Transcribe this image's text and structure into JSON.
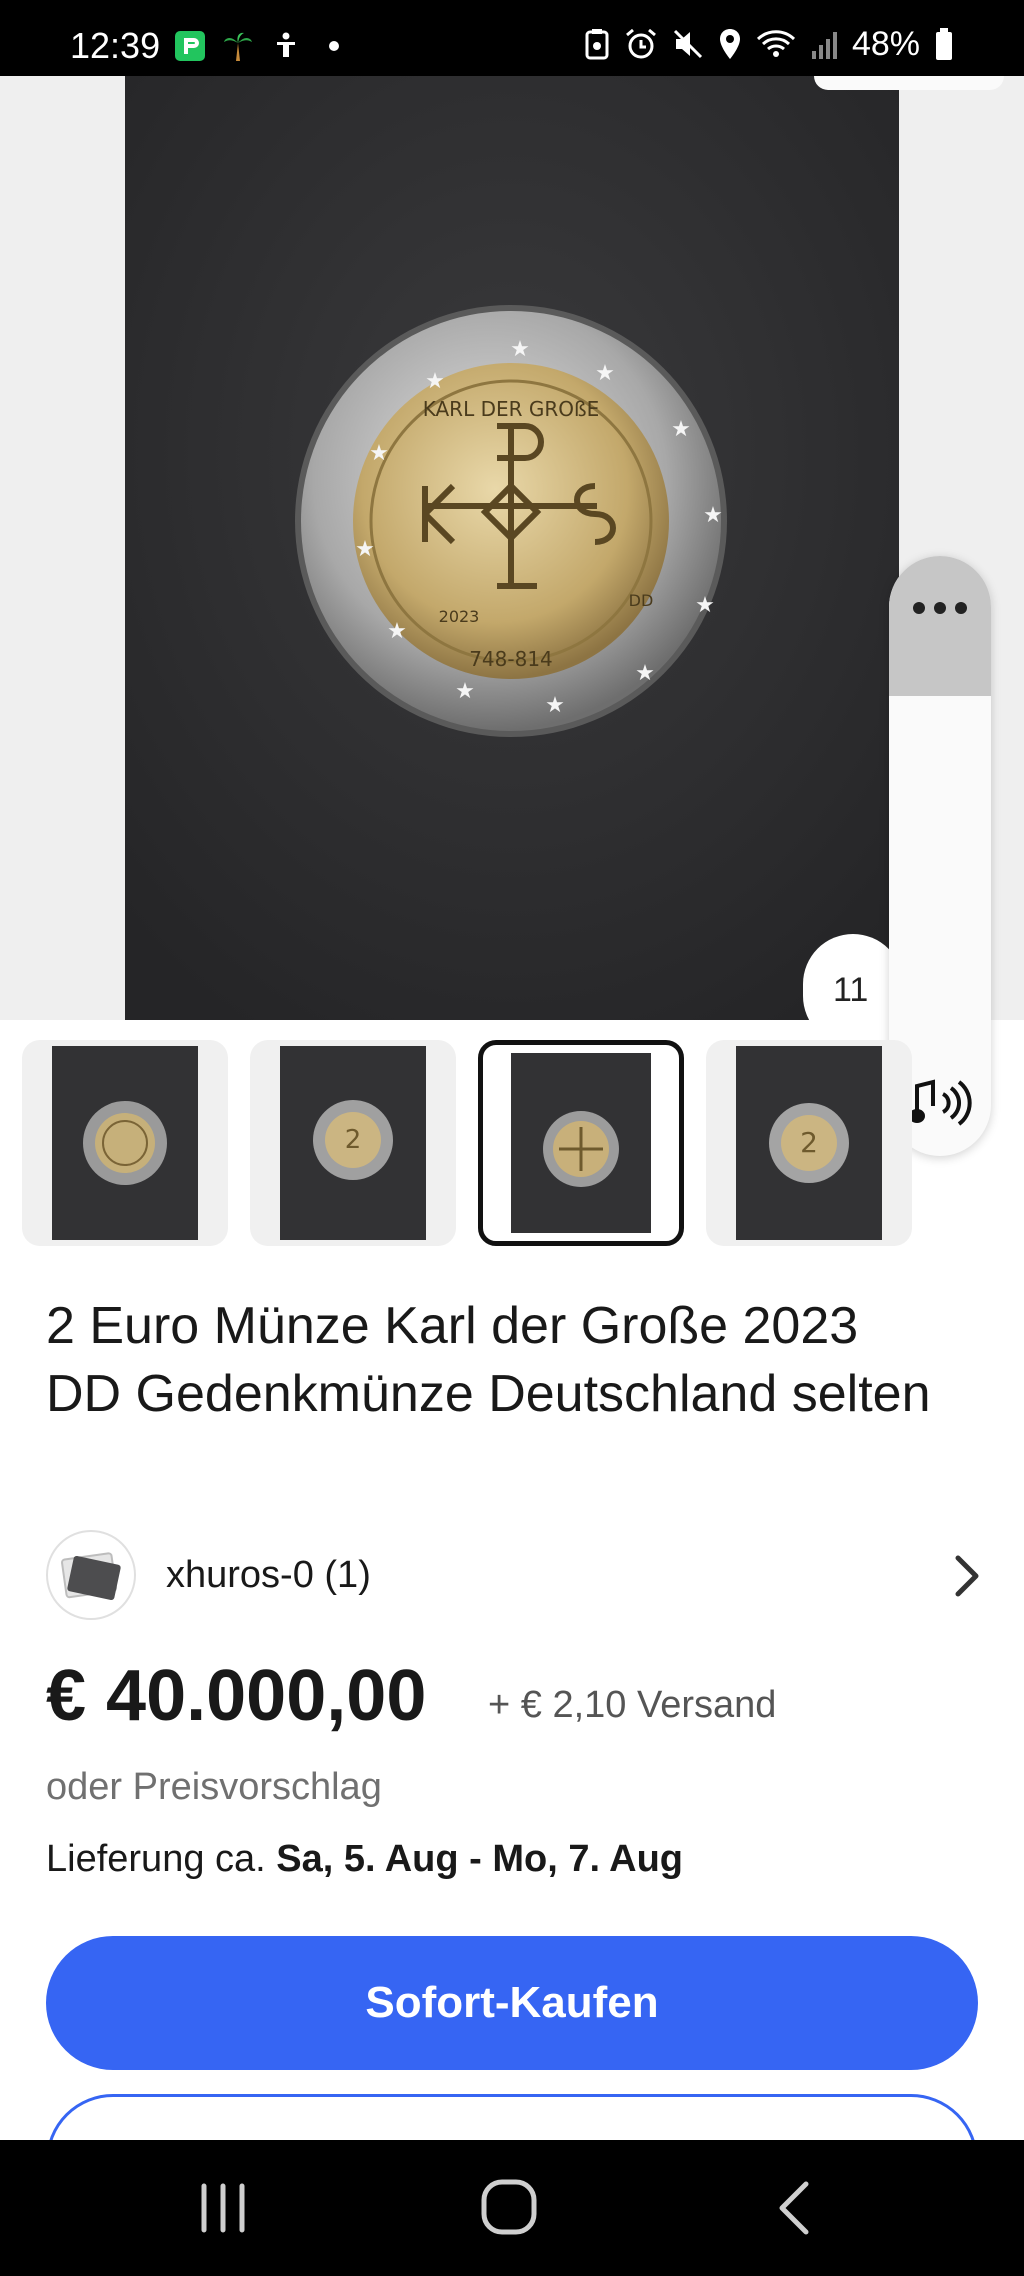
{
  "status_bar": {
    "time": "12:39",
    "battery_text": "48%",
    "left_icons": [
      "payment-app-icon",
      "palm-tree-icon",
      "accessibility-icon",
      "notification-dot-icon"
    ],
    "right_icons": [
      "save-icon",
      "alarm-icon",
      "mute-icon",
      "location-icon",
      "wifi-icon",
      "signal-icon",
      "battery-icon"
    ]
  },
  "gallery": {
    "counter": "11",
    "coin_inscription": "KARL DER GROßE",
    "coin_year": "2023",
    "coin_mint": "DD",
    "coin_dates": "748-814",
    "thumbnail_count": 4,
    "selected_thumbnail": 3
  },
  "listing": {
    "title": "2 Euro Münze Karl der Große 2023 DD Gedenkmünze Deutschland selten",
    "seller": "xhuros-0 (1)",
    "price": "€ 40.000,00",
    "shipping": "+ € 2,10 Versand",
    "offer": "oder Preisvorschlag",
    "delivery_prefix": "Lieferung ca. ",
    "delivery_dates": "Sa, 5. Aug - Mo, 7. Aug"
  },
  "actions": {
    "buy_now": "Sofort-Kaufen"
  },
  "colors": {
    "accent": "#3665f3",
    "status_bar": "#000000"
  },
  "nav": {
    "icons": [
      "recent-apps-icon",
      "home-icon",
      "back-icon"
    ]
  }
}
